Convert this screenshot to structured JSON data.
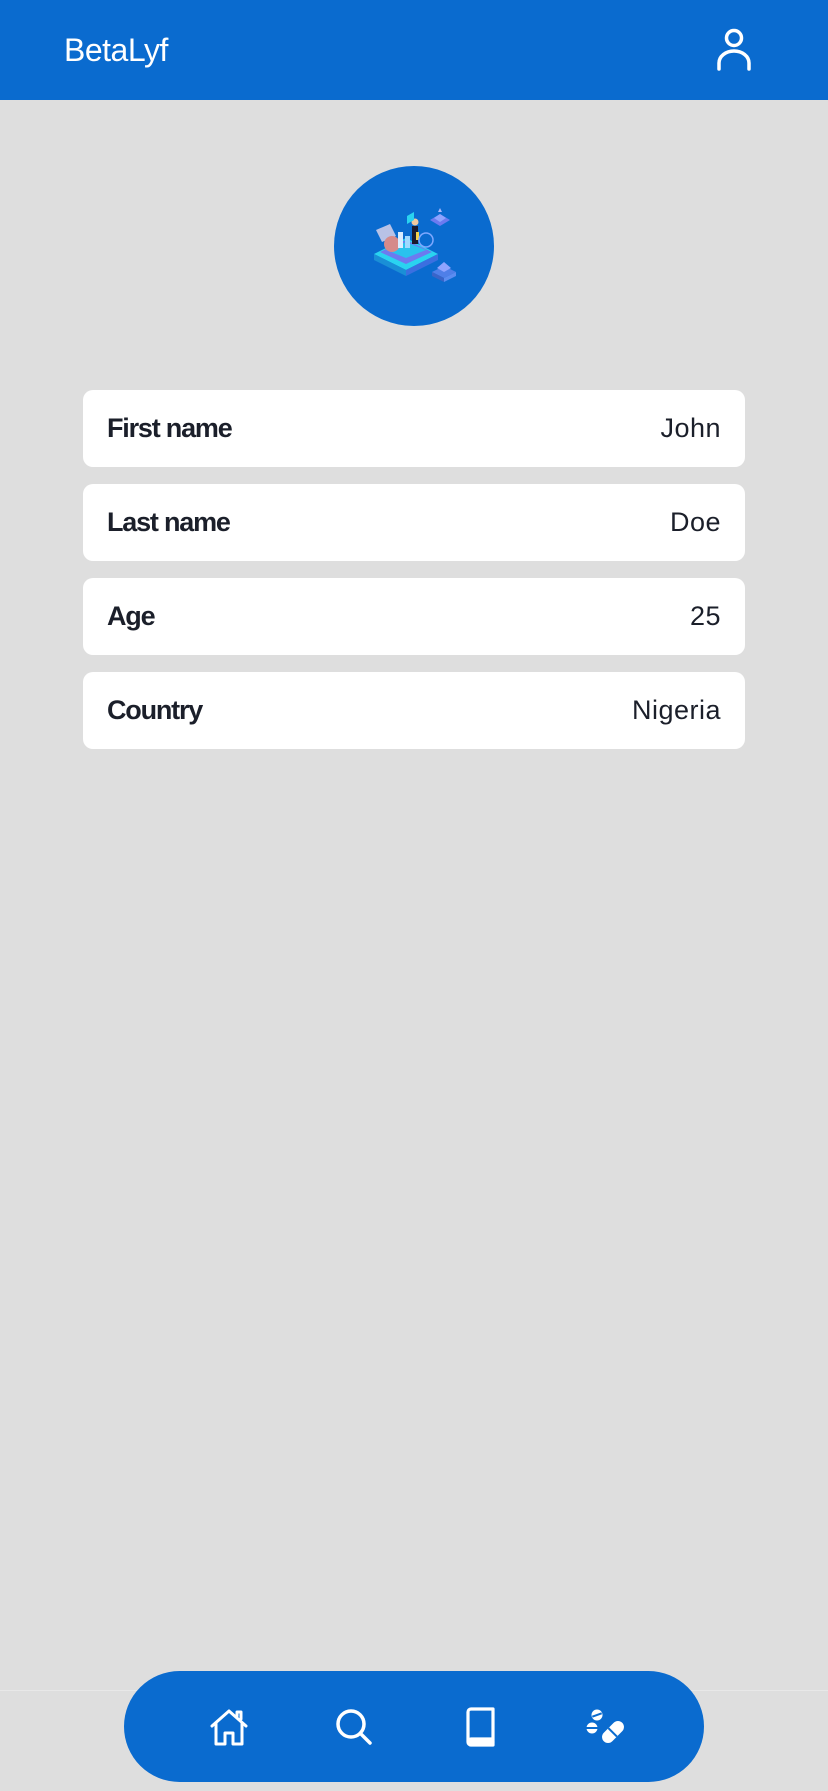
{
  "header": {
    "title": "BetaLyf",
    "profile_icon": "user-icon"
  },
  "avatar": {
    "icon": "isometric-illustration"
  },
  "profile": {
    "fields": [
      {
        "label": "First name",
        "value": "John"
      },
      {
        "label": "Last name",
        "value": "Doe"
      },
      {
        "label": "Age",
        "value": "25"
      },
      {
        "label": "Country",
        "value": "Nigeria"
      }
    ]
  },
  "bottom_nav": {
    "items": [
      {
        "icon": "home-icon"
      },
      {
        "icon": "search-icon"
      },
      {
        "icon": "book-icon"
      },
      {
        "icon": "pills-icon"
      }
    ]
  },
  "colors": {
    "brand": "#0a6bcf",
    "background": "#dedede",
    "card": "#ffffff",
    "text": "#1b1f2a"
  }
}
